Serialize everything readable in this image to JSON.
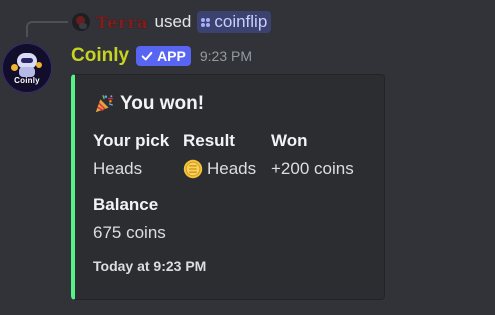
{
  "reply": {
    "username": "Terra",
    "used_text": "used",
    "command": "coinflip"
  },
  "message": {
    "avatar_text": "Coinly",
    "author": "Coinly",
    "app_tag": "APP",
    "timestamp": "9:23 PM"
  },
  "embed": {
    "title": "You won!",
    "accent_color": "#57f287",
    "fields": [
      {
        "name": "Your pick",
        "value": "Heads",
        "icon": ""
      },
      {
        "name": "Result",
        "value": "Heads",
        "icon": "coin-icon"
      },
      {
        "name": "Won",
        "value": "+200 coins",
        "icon": ""
      },
      {
        "name": "Balance",
        "value": "675 coins",
        "icon": ""
      }
    ],
    "footer": "Today at 9:23 PM"
  },
  "colors": {
    "background": "#313338",
    "embed_background": "#2b2d31",
    "bot_name": "#c7d321",
    "app_tag": "#5865f2",
    "reply_user": "#7c1f1f",
    "command_chip": "#3c4270"
  }
}
